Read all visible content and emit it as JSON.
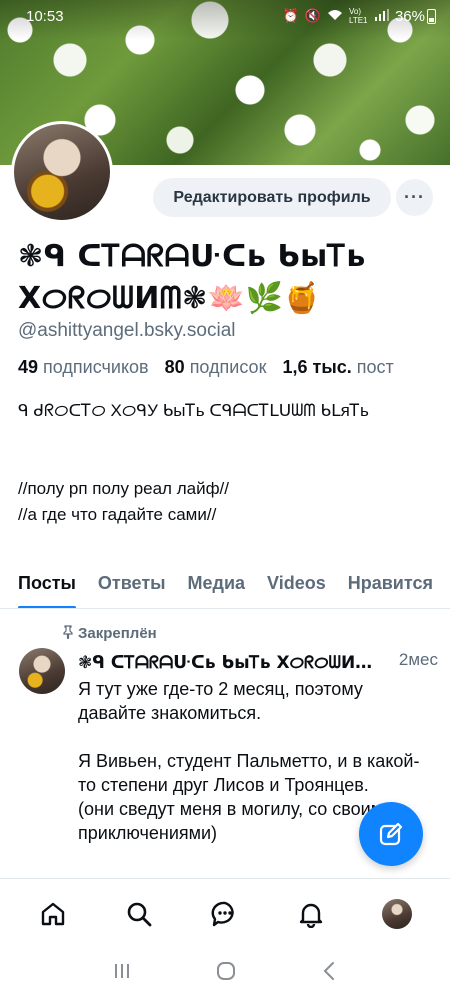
{
  "status_bar": {
    "time": "10:53",
    "signal_label": "Vo) LTE1",
    "battery": "36%"
  },
  "profile": {
    "edit_button": "Редактировать профиль",
    "more_button": "···",
    "display_name": "❃ᑫ ᑕᎢᗩᖇᗩᑘᑕь ᑲыᎢь ХᝪᖇᝪᗯИᗰ❃🪷🌿🍯",
    "handle": "@ashittyangel.bsky.social",
    "stats": {
      "followers_count": "49",
      "followers_label": "подписчиков",
      "following_count": "80",
      "following_label": "подписок",
      "posts_count": "1,6 тыс.",
      "posts_label": "пост"
    },
    "bio": "ᑫ ᑯᖇᝪᑕᎢᝪ ХᝪᑫУ ᑲыᎢь ᑕᑫᗩᑕᎢᒪᑌᗯᗰ ᑲᒪяᎢь\n\n\n//полу рп полу реал лайф//\n//а где что гадайте сами//"
  },
  "tabs": [
    "Посты",
    "Ответы",
    "Медиа",
    "Videos",
    "Нравится"
  ],
  "post": {
    "pinned_label": "Закреплён",
    "author": "❃ᑫ ᑕᎢᗩᖇᗩᑘᑕь ᑲыᎢь ХᝪᖇᝪᗯИᗰ…",
    "time": "2мес",
    "text": "Я тут уже где-то 2 месяц, поэтому давайте знакомиться.\n\nЯ Вивьен, студент Пальметто, и в какой-то степени друг Лисов и Троянцев.\n(они сведут меня в могилу, со своими приключениями)"
  },
  "colors": {
    "accent": "#1083fe",
    "muted_text": "#5d6c7b",
    "button_bg": "#eef2f6"
  },
  "icons": {
    "fab": "compose-icon",
    "nav": [
      "home-icon",
      "search-icon",
      "chat-icon",
      "bell-icon",
      "profile-avatar"
    ],
    "system": [
      "recents-icon",
      "home-circle-icon",
      "back-icon"
    ]
  }
}
